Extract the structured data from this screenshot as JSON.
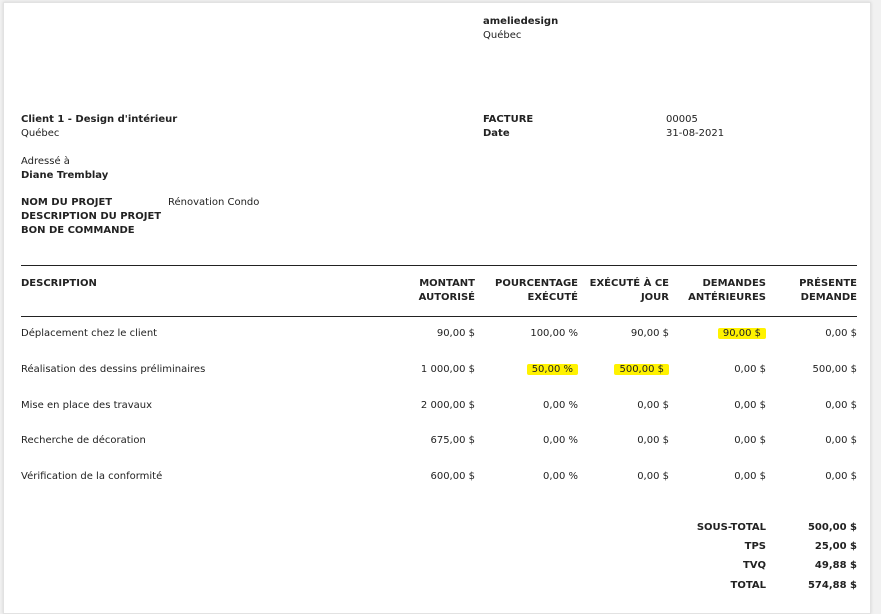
{
  "company": {
    "name": "ameliedesign",
    "location": "Québec"
  },
  "client": {
    "name": "Client 1 - Design d'intérieur",
    "location": "Québec"
  },
  "invoice": {
    "facture_label": "FACTURE",
    "facture_value": "00005",
    "date_label": "Date",
    "date_value": "31-08-2021"
  },
  "address": {
    "label": "Adressé à",
    "name": "Diane Tremblay"
  },
  "project": {
    "nom_label": "NOM DU PROJET",
    "nom_value": "Rénovation Condo",
    "desc_label": "DESCRIPTION DU PROJET",
    "bon_label": "BON DE COMMANDE"
  },
  "table": {
    "headers": {
      "description": "DESCRIPTION",
      "montant_1": "MONTANT",
      "montant_2": "AUTORISÉ",
      "pourcentage_1": "POURCENTAGE",
      "pourcentage_2": "EXÉCUTÉ",
      "execute_1": "EXÉCUTÉ À CE",
      "execute_2": "JOUR",
      "demandes_1": "DEMANDES",
      "demandes_2": "ANTÉRIEURES",
      "presente_1": "PRÉSENTE",
      "presente_2": "DEMANDE"
    },
    "rows": [
      {
        "description": "Déplacement chez le client",
        "montant": "90,00 $",
        "pourcentage": "100,00 %",
        "execute": "90,00 $",
        "demandes": "90,00 $",
        "presente": "0,00 $"
      },
      {
        "description": "Réalisation des dessins préliminaires",
        "montant": "1 000,00 $",
        "pourcentage": "50,00 %",
        "execute": "500,00 $",
        "demandes": "0,00 $",
        "presente": "500,00 $"
      },
      {
        "description": "Mise en place des travaux",
        "montant": "2 000,00 $",
        "pourcentage": "0,00 %",
        "execute": "0,00 $",
        "demandes": "0,00 $",
        "presente": "0,00 $"
      },
      {
        "description": "Recherche de décoration",
        "montant": "675,00 $",
        "pourcentage": "0,00 %",
        "execute": "0,00 $",
        "demandes": "0,00 $",
        "presente": "0,00 $"
      },
      {
        "description": "Vérification de la conformité",
        "montant": "600,00 $",
        "pourcentage": "0,00 %",
        "execute": "0,00 $",
        "demandes": "0,00 $",
        "presente": "0,00 $"
      }
    ]
  },
  "totals": {
    "sous_total_label": "SOUS-TOTAL",
    "sous_total": "500,00 $",
    "tps_label": "TPS",
    "tps": "25,00 $",
    "tvq_label": "TVQ",
    "tvq": "49,88 $",
    "total_label": "TOTAL",
    "total": "574,88 $"
  },
  "highlight_color": "#fff200"
}
